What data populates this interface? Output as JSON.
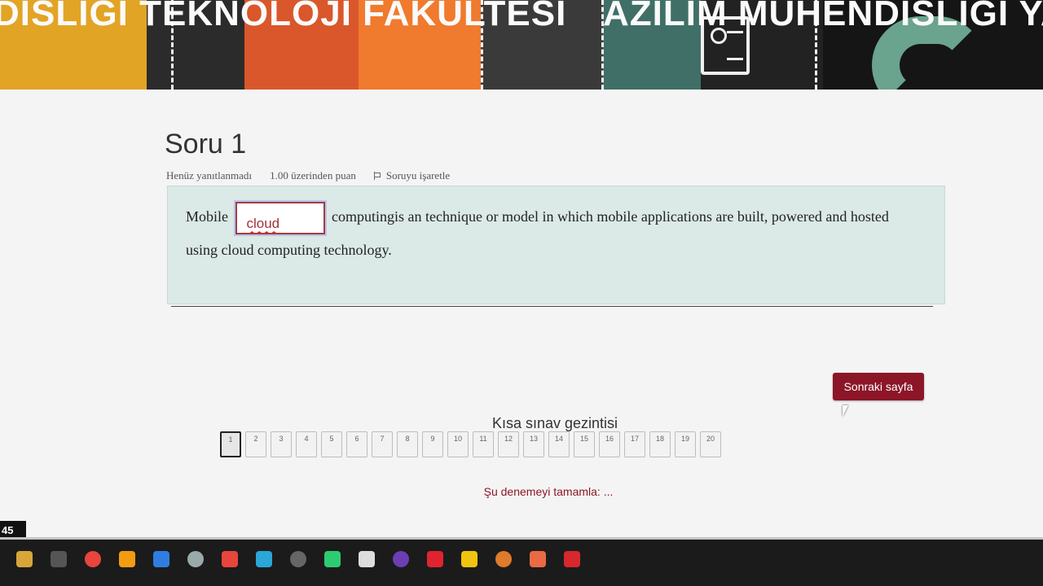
{
  "banner": {
    "left_text": "DISLIGI TEKNOLOJI FAKULTESI",
    "right_text": "AZILIM MÜHENDISLIGI YAZIL"
  },
  "question": {
    "title": "Soru 1",
    "status": "Henüz yanıtlanmadı",
    "points": "1.00 üzerinden puan",
    "flag_label": "Soruyu işaretle",
    "text_before": "Mobile",
    "answer_value": "cloud",
    "text_after": "computingis an technique or model in which mobile applications are built, powered and hosted using cloud computing technology."
  },
  "next_button": "Sonraki sayfa",
  "nav": {
    "title": "Kısa sınav gezintisi",
    "buttons": [
      "1",
      "2",
      "3",
      "4",
      "5",
      "6",
      "7",
      "8",
      "9",
      "10",
      "11",
      "12",
      "13",
      "14",
      "15",
      "16",
      "17",
      "18",
      "19",
      "20"
    ],
    "current": "1",
    "finish_link": "Şu denemeyi tamamla: ..."
  },
  "clock_fragment": "45",
  "colors": {
    "accent": "#8c1627",
    "question_bg": "#dbe9e7",
    "taskbar": "#1b1b1b"
  },
  "taskbar_icons": [
    "file-manager-icon",
    "store-icon",
    "chrome-icon",
    "vlc-icon",
    "vscode-icon",
    "cursor-icon",
    "chrome-icon",
    "phone-icon",
    "terminal-icon",
    "whatsapp-icon",
    "obs-icon",
    "visual-studio-icon",
    "opera-icon",
    "paint-icon",
    "app-icon",
    "ubuntu-icon",
    "acrobat-icon"
  ]
}
